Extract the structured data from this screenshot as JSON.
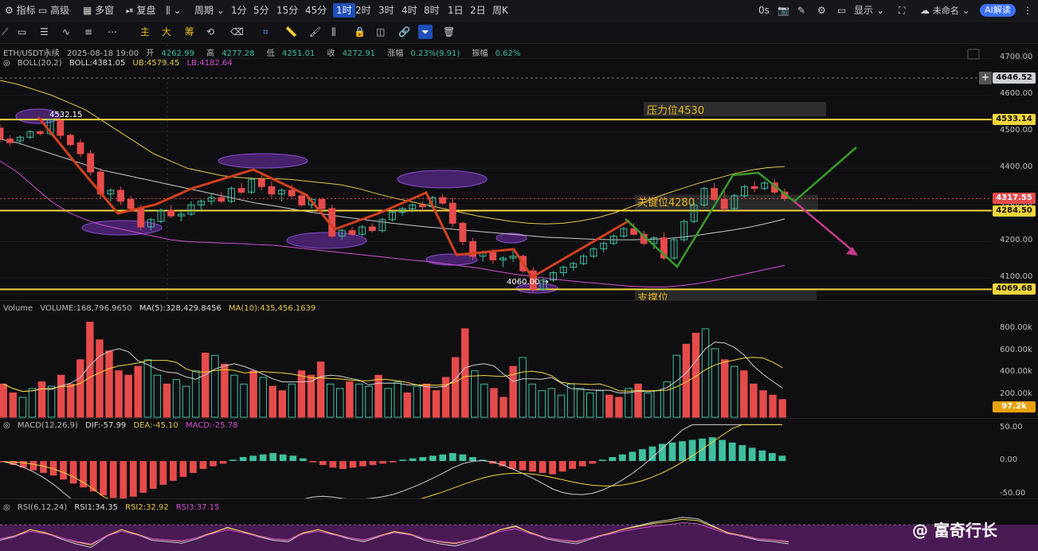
{
  "topbar": {
    "indicators": "指标",
    "advanced": "高级",
    "multi_window": "多窗",
    "replay": "复盘",
    "period": "周期",
    "timeframes": [
      "1分",
      "5分",
      "15分",
      "45分",
      "1时",
      "2时",
      "3时",
      "4时",
      "8时",
      "1日",
      "2日",
      "周K"
    ],
    "active_timeframe": "1时",
    "countdown": "0s",
    "display": "显示",
    "unnamed": "未命名",
    "ai_read": "AI解读"
  },
  "drawtools": {
    "main": "主",
    "big": "大",
    "chips": "筹"
  },
  "header": {
    "symbol": "ETH/USDT永续",
    "datetime": "2025-08-18 19:00",
    "open_label": "开",
    "open": "4262.99",
    "high_label": "高",
    "high": "4277.28",
    "low_label": "低",
    "low": "4251.01",
    "close_label": "收",
    "close": "4272.91",
    "change_label": "涨幅",
    "change": "0.23%(9.91)",
    "amp_label": "振幅",
    "amp": "0.62%"
  },
  "boll": {
    "name": "BOLL(20,2)",
    "mid": "BOLL:4381.05",
    "ub": "UB:4579.45",
    "lb": "LB:4182.64"
  },
  "volume_legend": {
    "name": "Volume",
    "volume": "VOLUME:168,796.9650",
    "ma5": "MA(5):328,429.8456",
    "ma10": "MA(10):435,456.1639"
  },
  "macd_legend": {
    "name": "MACD(12,26,9)",
    "dif": "DIF:-57.99",
    "dea": "DEA:-45.10",
    "macd": "MACD:-25.78"
  },
  "rsi_legend": {
    "name": "RSI(6,12,24)",
    "rsi1": "RSI1:34.35",
    "rsi2": "RSI2:32.92",
    "rsi3": "RSI3:37.15"
  },
  "annotations": {
    "resistance": "压力位4530",
    "key": "关键位4280",
    "support": "支撑位",
    "high_label": "4532.15",
    "low_label": "4060.00"
  },
  "price_axis": {
    "ticks": [
      "4700.00",
      "4600.00",
      "4500.00",
      "4400.00",
      "4300.00",
      "4200.00",
      "4100.00"
    ],
    "tags": {
      "crosshair": "4646.52",
      "resistance": "4533.14",
      "current": "4317.55",
      "key": "4284.50",
      "support": "4069.68"
    }
  },
  "volume_axis": {
    "ticks": [
      "800.00k",
      "600.00k",
      "400.00k",
      "200.00k"
    ],
    "tag": "97.2k"
  },
  "macd_axis": {
    "ticks": [
      "50.00",
      "0.00",
      "-50.00"
    ]
  },
  "watermark": "@ 富奇行长",
  "colors": {
    "up": "#3fbfa0",
    "down": "#e64b4b",
    "yellow": "#f2d43d",
    "boll_mid": "#c8c8c8",
    "boll_ub": "#e6c64a",
    "boll_lb": "#d34fd1",
    "red_line": "#d2401f",
    "green_line": "#3a9a2a",
    "magenta_arrow": "#c83a8a",
    "active": "#1f4fb8"
  },
  "chart_data": {
    "type": "candlestick",
    "price_range": [
      4040,
      4740
    ],
    "candles": [
      [
        4510,
        4520,
        4470,
        4480
      ],
      [
        4480,
        4490,
        4460,
        4470
      ],
      [
        4475,
        4490,
        4465,
        4485
      ],
      [
        4485,
        4505,
        4480,
        4500
      ],
      [
        4500,
        4505,
        4490,
        4495
      ],
      [
        4495,
        4535,
        4490,
        4532
      ],
      [
        4530,
        4535,
        4480,
        4490
      ],
      [
        4490,
        4495,
        4460,
        4465
      ],
      [
        4470,
        4480,
        4430,
        4440
      ],
      [
        4440,
        4450,
        4380,
        4390
      ],
      [
        4390,
        4400,
        4320,
        4330
      ],
      [
        4330,
        4345,
        4310,
        4340
      ],
      [
        4340,
        4350,
        4300,
        4310
      ],
      [
        4315,
        4325,
        4280,
        4290
      ],
      [
        4290,
        4300,
        4230,
        4240
      ],
      [
        4240,
        4265,
        4230,
        4260
      ],
      [
        4255,
        4290,
        4250,
        4285
      ],
      [
        4285,
        4300,
        4265,
        4270
      ],
      [
        4270,
        4285,
        4255,
        4275
      ],
      [
        4275,
        4310,
        4270,
        4300
      ],
      [
        4300,
        4315,
        4285,
        4310
      ],
      [
        4310,
        4330,
        4300,
        4320
      ],
      [
        4320,
        4335,
        4305,
        4310
      ],
      [
        4310,
        4350,
        4305,
        4345
      ],
      [
        4345,
        4360,
        4330,
        4335
      ],
      [
        4335,
        4375,
        4330,
        4370
      ],
      [
        4370,
        4380,
        4340,
        4350
      ],
      [
        4350,
        4365,
        4320,
        4330
      ],
      [
        4330,
        4345,
        4310,
        4340
      ],
      [
        4340,
        4355,
        4320,
        4325
      ],
      [
        4325,
        4335,
        4295,
        4300
      ],
      [
        4300,
        4320,
        4290,
        4315
      ],
      [
        4315,
        4320,
        4280,
        4290
      ],
      [
        4290,
        4300,
        4210,
        4215
      ],
      [
        4215,
        4235,
        4205,
        4230
      ],
      [
        4230,
        4240,
        4215,
        4220
      ],
      [
        4220,
        4245,
        4215,
        4240
      ],
      [
        4240,
        4250,
        4225,
        4230
      ],
      [
        4230,
        4265,
        4225,
        4260
      ],
      [
        4260,
        4285,
        4255,
        4280
      ],
      [
        4280,
        4295,
        4270,
        4290
      ],
      [
        4290,
        4305,
        4280,
        4300
      ],
      [
        4300,
        4310,
        4285,
        4295
      ],
      [
        4295,
        4325,
        4290,
        4320
      ],
      [
        4320,
        4330,
        4300,
        4305
      ],
      [
        4305,
        4320,
        4240,
        4250
      ],
      [
        4250,
        4255,
        4190,
        4200
      ],
      [
        4200,
        4210,
        4150,
        4160
      ],
      [
        4160,
        4175,
        4145,
        4170
      ],
      [
        4170,
        4180,
        4140,
        4150
      ],
      [
        4150,
        4160,
        4130,
        4155
      ],
      [
        4155,
        4175,
        4145,
        4160
      ],
      [
        4160,
        4165,
        4115,
        4120
      ],
      [
        4120,
        4130,
        4060,
        4070
      ],
      [
        4070,
        4100,
        4065,
        4095
      ],
      [
        4095,
        4120,
        4090,
        4115
      ],
      [
        4115,
        4135,
        4105,
        4130
      ],
      [
        4130,
        4145,
        4120,
        4140
      ],
      [
        4140,
        4165,
        4135,
        4160
      ],
      [
        4160,
        4185,
        4155,
        4180
      ],
      [
        4180,
        4200,
        4170,
        4195
      ],
      [
        4195,
        4220,
        4190,
        4215
      ],
      [
        4215,
        4240,
        4210,
        4235
      ],
      [
        4235,
        4250,
        4215,
        4220
      ],
      [
        4220,
        4230,
        4190,
        4195
      ],
      [
        4195,
        4215,
        4180,
        4210
      ],
      [
        4210,
        4225,
        4150,
        4155
      ],
      [
        4155,
        4210,
        4150,
        4205
      ],
      [
        4205,
        4260,
        4200,
        4255
      ],
      [
        4255,
        4305,
        4250,
        4300
      ],
      [
        4300,
        4350,
        4295,
        4345
      ],
      [
        4345,
        4360,
        4310,
        4315
      ],
      [
        4315,
        4340,
        4280,
        4290
      ],
      [
        4290,
        4330,
        4285,
        4325
      ],
      [
        4325,
        4355,
        4320,
        4350
      ],
      [
        4350,
        4365,
        4335,
        4345
      ],
      [
        4345,
        4365,
        4340,
        4360
      ],
      [
        4360,
        4370,
        4330,
        4335
      ],
      [
        4335,
        4345,
        4310,
        4318
      ]
    ],
    "boll_mid": [
      4480,
      4470,
      4455,
      4440,
      4425,
      4410,
      4395,
      4385,
      4375,
      4365,
      4355,
      4345,
      4335,
      4325,
      4315,
      4305,
      4298,
      4290,
      4282,
      4275,
      4268,
      4262,
      4256,
      4250,
      4245,
      4240,
      4236,
      4232,
      4228,
      4224,
      4220,
      4216,
      4212,
      4210,
      4208,
      4206,
      4205,
      4205,
      4206,
      4208,
      4212,
      4218,
      4225,
      4232,
      4240,
      4250,
      4262
    ],
    "boll_ub": [
      4640,
      4630,
      4615,
      4600,
      4580,
      4560,
      4530,
      4500,
      4470,
      4440,
      4420,
      4400,
      4390,
      4380,
      4375,
      4372,
      4372,
      4370,
      4365,
      4360,
      4355,
      4345,
      4332,
      4320,
      4310,
      4300,
      4290,
      4280,
      4270,
      4262,
      4255,
      4250,
      4248,
      4250,
      4256,
      4265,
      4278,
      4295,
      4312,
      4330,
      4345,
      4360,
      4372,
      4385,
      4395,
      4402,
      4405
    ],
    "boll_lb": [
      4420,
      4390,
      4350,
      4310,
      4280,
      4260,
      4245,
      4235,
      4225,
      4215,
      4205,
      4200,
      4198,
      4196,
      4195,
      4192,
      4190,
      4185,
      4180,
      4175,
      4170,
      4165,
      4160,
      4155,
      4150,
      4146,
      4140,
      4134,
      4128,
      4120,
      4112,
      4106,
      4100,
      4095,
      4090,
      4086,
      4082,
      4078,
      4076,
      4076,
      4080,
      4086,
      4095,
      4105,
      4115,
      4125,
      4135
    ],
    "volume_k": [
      300,
      220,
      180,
      260,
      320,
      280,
      380,
      300,
      520,
      860,
      700,
      600,
      420,
      380,
      460,
      520,
      380,
      300,
      340,
      280,
      420,
      580,
      560,
      480,
      380,
      300,
      420,
      360,
      280,
      240,
      300,
      420,
      380,
      500,
      300,
      260,
      320,
      300,
      280,
      380,
      260,
      320,
      220,
      280,
      300,
      240,
      360,
      540,
      800,
      420,
      300,
      260,
      180,
      460,
      540,
      300,
      240,
      260,
      200,
      300,
      260,
      220,
      240,
      200,
      180,
      260,
      300,
      220,
      240,
      320,
      560,
      660,
      760,
      800,
      620,
      520,
      460,
      420,
      300,
      240,
      200,
      160
    ],
    "volume_up": [
      false,
      false,
      true,
      true,
      false,
      true,
      false,
      false,
      false,
      false,
      false,
      false,
      false,
      false,
      false,
      true,
      true,
      false,
      true,
      true,
      true,
      false,
      true,
      false,
      true,
      true,
      false,
      true,
      false,
      false,
      true,
      false,
      false,
      false,
      true,
      true,
      false,
      true,
      true,
      false,
      true,
      true,
      false,
      true,
      false,
      false,
      false,
      false,
      false,
      true,
      true,
      false,
      false,
      false,
      true,
      true,
      true,
      true,
      true,
      true,
      true,
      true,
      true,
      false,
      false,
      true,
      false,
      true,
      true,
      true,
      true,
      false,
      false,
      true,
      true,
      false,
      true,
      false,
      false,
      false,
      false,
      false
    ],
    "macd_hist": [
      -2,
      -6,
      -10,
      -14,
      -18,
      -22,
      -28,
      -34,
      -40,
      -46,
      -52,
      -56,
      -58,
      -54,
      -48,
      -42,
      -36,
      -30,
      -24,
      -18,
      -12,
      -8,
      -4,
      2,
      6,
      8,
      10,
      12,
      10,
      8,
      4,
      -2,
      -6,
      -10,
      -12,
      -10,
      -8,
      -6,
      -4,
      -2,
      2,
      4,
      6,
      8,
      10,
      12,
      10,
      6,
      2,
      -4,
      -8,
      -12,
      -14,
      -16,
      -18,
      -20,
      -16,
      -12,
      -8,
      -4,
      2,
      6,
      10,
      14,
      18,
      22,
      26,
      28,
      30,
      32,
      34,
      36,
      32,
      28,
      24,
      20,
      16,
      12,
      8
    ],
    "rsi_values": [
      40,
      45,
      55,
      50,
      42,
      35,
      30,
      45,
      55,
      48,
      40,
      38,
      36,
      42,
      50,
      58,
      52,
      45,
      40,
      38,
      50,
      55,
      48,
      42,
      38,
      45,
      52,
      48,
      40,
      35,
      32,
      38,
      45,
      55,
      60,
      50,
      42,
      38,
      35,
      42,
      48,
      55,
      60,
      65,
      68,
      72,
      70,
      60,
      50,
      45,
      40,
      38,
      35
    ]
  }
}
